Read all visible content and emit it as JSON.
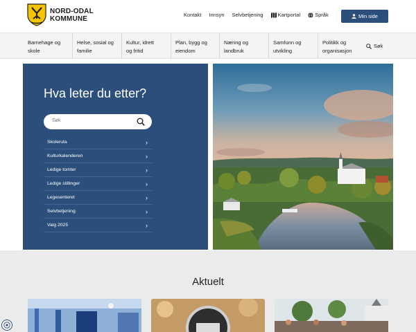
{
  "header": {
    "logo_line1": "NORD-ODAL",
    "logo_line2": "KOMMUNE",
    "links": [
      {
        "label": "Kontakt",
        "icon": ""
      },
      {
        "label": "Innsyn",
        "icon": ""
      },
      {
        "label": "Selvbetjening",
        "icon": ""
      },
      {
        "label": "Kartportal",
        "icon": "map-icon"
      },
      {
        "label": "Språk",
        "icon": "globe-icon"
      }
    ],
    "my_page_label": "Min side",
    "my_page_icon": "user-icon",
    "brand_color": "#2b4f7a"
  },
  "nav": {
    "items": [
      {
        "line1": "Barnehage og",
        "line2": "skole"
      },
      {
        "line1": "Helse, sosial og",
        "line2": "familie"
      },
      {
        "line1": "Kultur, idrett",
        "line2": "og fritid"
      },
      {
        "line1": "Plan, bygg og",
        "line2": "eiendom"
      },
      {
        "line1": "Næring og",
        "line2": "landbruk"
      },
      {
        "line1": "Samfunn og",
        "line2": "utvikling"
      },
      {
        "line1": "Politikk og",
        "line2": "organisasjon"
      }
    ],
    "search_label": "Søk",
    "search_icon": "search-icon"
  },
  "hero": {
    "title": "Hva leter du etter?",
    "search_placeholder": "Søk",
    "quick_links": [
      "Skoleruta",
      "Kulturkalenderen",
      "Ledige tomter",
      "Ledige stillinger",
      "Legesenteret",
      "Selvbetjening",
      "Valg 2025"
    ],
    "chevron": "›"
  },
  "news": {
    "title": "Aktuelt"
  }
}
